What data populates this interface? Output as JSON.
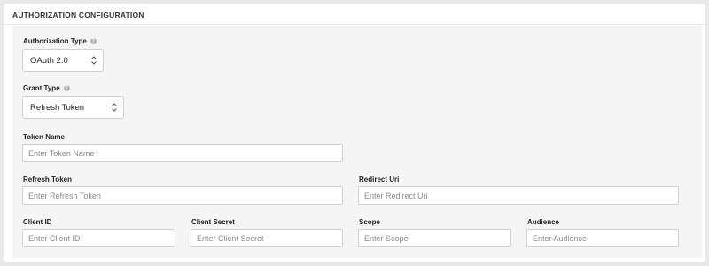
{
  "section": {
    "title": "AUTHORIZATION CONFIGURATION"
  },
  "auth_type": {
    "label": "Authorization Type",
    "value": "OAuth 2.0",
    "help_icon": "help-icon"
  },
  "grant_type": {
    "label": "Grant Type",
    "value": "Refresh Token",
    "help_icon": "help-icon"
  },
  "token_name": {
    "label": "Token Name",
    "placeholder": "Enter Token Name"
  },
  "refresh_token": {
    "label": "Refresh Token",
    "placeholder": "Enter Refresh Token"
  },
  "redirect_uri": {
    "label": "Redirect Uri",
    "placeholder": "Enter Redirect Uri"
  },
  "client_id": {
    "label": "Client ID",
    "placeholder": "Enter Client ID"
  },
  "client_secret": {
    "label": "Client Secret",
    "placeholder": "Enter Client Secret"
  },
  "scope": {
    "label": "Scope",
    "placeholder": "Enter Scope"
  },
  "audience": {
    "label": "Audience",
    "placeholder": "Enter Audience"
  }
}
